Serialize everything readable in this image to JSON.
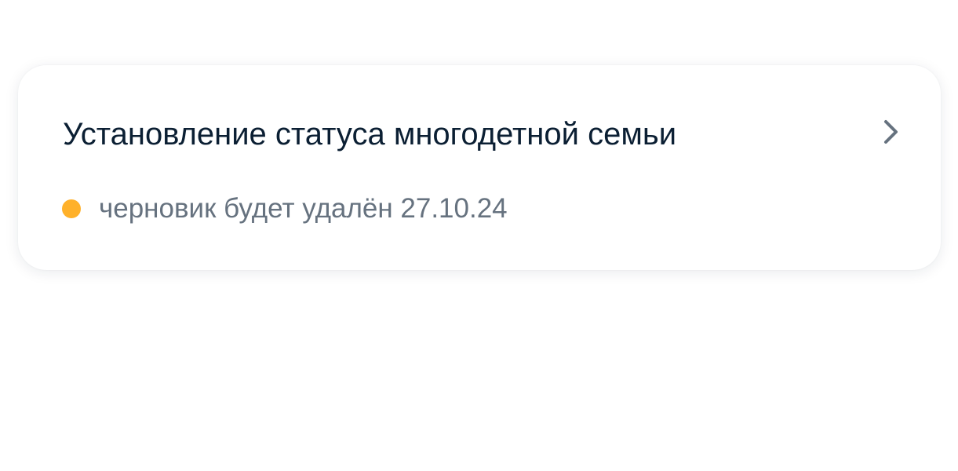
{
  "header": {
    "title": ""
  },
  "card": {
    "title": "Установление статуса многодетной семьи",
    "status_text": "черновик будет удалён 27.10.24",
    "status_color": "#ffb12a",
    "action_icon": "chevron-right-icon"
  }
}
